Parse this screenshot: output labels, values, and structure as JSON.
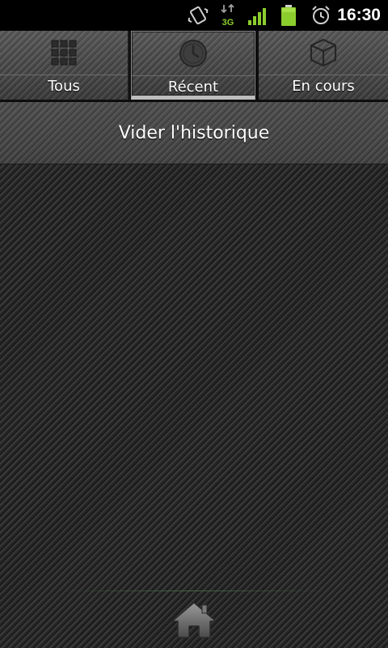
{
  "status_bar": {
    "time": "16:30",
    "network_type": "3G",
    "icons": [
      "vibrate-icon",
      "data-icon",
      "signal-icon",
      "battery-icon",
      "alarm-icon"
    ],
    "colors": {
      "signal": "#8ccd2e",
      "battery": "#8ccd2e",
      "data_arrows": "#9e9e9e"
    }
  },
  "tabs": [
    {
      "label": "Tous",
      "icon": "grid-icon",
      "selected": false
    },
    {
      "label": "Récent",
      "icon": "clock-icon",
      "selected": true
    },
    {
      "label": "En cours",
      "icon": "cube-icon",
      "selected": false
    }
  ],
  "clear_history": {
    "label": "Vider l'historique"
  },
  "bottom_bar": {
    "home_icon": "home-icon"
  }
}
